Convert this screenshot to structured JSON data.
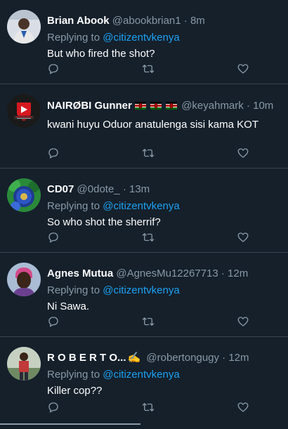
{
  "tweets": [
    {
      "name": "Brian Abook",
      "handle": "@abookbrian1",
      "time": "8m",
      "replying_prefix": "Replying to ",
      "replying_to": "@citizentvkenya",
      "text": "But who fired the shot?",
      "avatar_icon": "person-avatar-icon",
      "avatar_color": "#cfd8e3"
    },
    {
      "name": "NAIRØBI Gunner",
      "handle": "@keyahmark",
      "time": "10m",
      "replying_prefix": "",
      "replying_to": "",
      "text": "kwani huyu Oduor anatulenga sisi kama KOT",
      "avatar_icon": "nairobi-gunners-logo-icon",
      "avatar_color": "#1a1a1a",
      "badge_icons": [
        "kenya-flag-icon",
        "kenya-flag-icon",
        "kenya-flag-icon"
      ]
    },
    {
      "name": "CD07",
      "handle": "@0dote_",
      "time": "13m",
      "replying_prefix": "Replying to ",
      "replying_to": "@citizentvkenya",
      "text": "So who shot the sherrif?",
      "avatar_icon": "chelsea-crest-avatar-icon",
      "avatar_color": "#1e3c8f"
    },
    {
      "name": "Agnes Mutua",
      "handle": "@AgnesMu12267713",
      "time": "12m",
      "replying_prefix": "Replying to ",
      "replying_to": "@citizentvkenya",
      "text": "Ni Sawa.",
      "avatar_icon": "person-avatar-icon",
      "avatar_color": "#9bb0c9"
    },
    {
      "name": "R O B E R T O...",
      "name_emoji": "✍",
      "handle": "@robertongugy",
      "time": "12m",
      "replying_prefix": "Replying to ",
      "replying_to": "@citizentvkenya",
      "text": "Killer cop??",
      "avatar_icon": "person-avatar-icon",
      "avatar_color": "#8fa08a"
    }
  ],
  "separator": "·",
  "colors": {
    "background": "#15202b",
    "text": "#ffffff",
    "muted": "#8899a6",
    "link": "#1da1f2",
    "divider": "#38444d"
  },
  "action_icons": [
    "reply-icon",
    "retweet-icon",
    "like-icon"
  ]
}
